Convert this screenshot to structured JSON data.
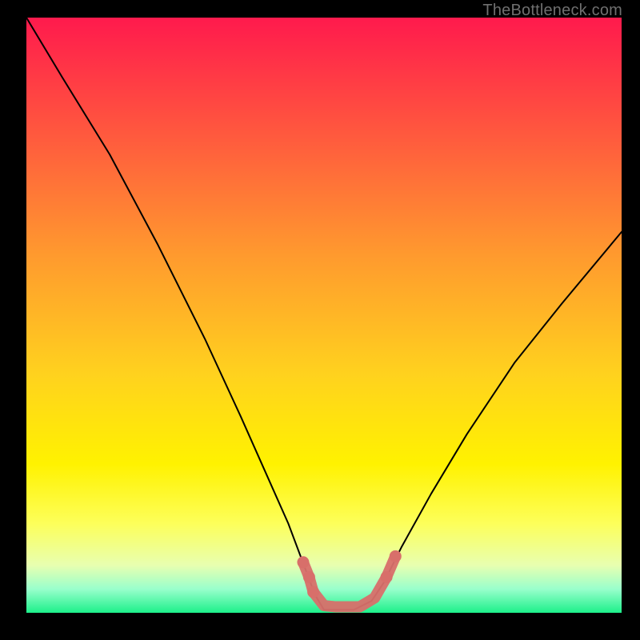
{
  "watermark": "TheBottleneck.com",
  "chart_data": {
    "type": "line",
    "title": "",
    "xlabel": "",
    "ylabel": "",
    "xlim": [
      0,
      100
    ],
    "ylim": [
      0,
      100
    ],
    "series": [
      {
        "name": "bottleneck-curve",
        "x": [
          0,
          6,
          14,
          22,
          30,
          36,
          40,
          44,
          47,
          48.5,
          50,
          52,
          55,
          58,
          60,
          63,
          68,
          74,
          82,
          90,
          100
        ],
        "y": [
          100,
          90,
          77,
          62,
          46,
          33,
          24,
          15,
          7,
          3,
          0.5,
          0.5,
          0.5,
          2,
          5,
          11,
          20,
          30,
          42,
          52,
          64
        ]
      }
    ],
    "markers": {
      "name": "highlight-segment",
      "color": "#d86f6a",
      "points": [
        {
          "x": 46.5,
          "y": 8.5
        },
        {
          "x": 47.5,
          "y": 6
        },
        {
          "x": 48.2,
          "y": 3.5
        },
        {
          "x": 50,
          "y": 1.2
        },
        {
          "x": 52,
          "y": 1.0
        },
        {
          "x": 54,
          "y": 1.0
        },
        {
          "x": 56,
          "y": 1.0
        },
        {
          "x": 58.5,
          "y": 2.5
        },
        {
          "x": 60.5,
          "y": 6
        },
        {
          "x": 62,
          "y": 9.5
        }
      ]
    },
    "background_gradient": {
      "top": "#ff1a4d",
      "mid": "#fff200",
      "bottom": "#1df08a"
    }
  }
}
